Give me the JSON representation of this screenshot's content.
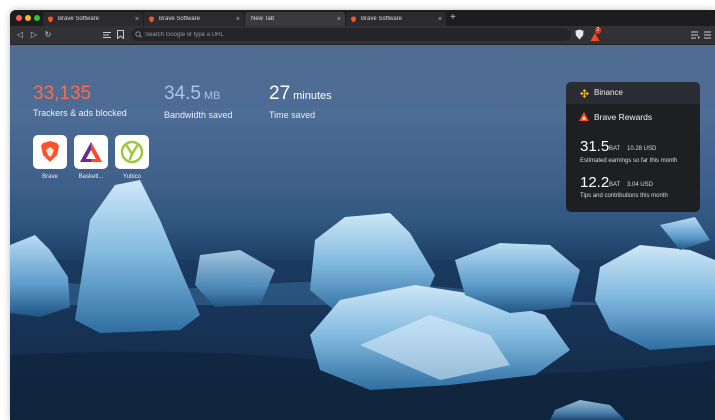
{
  "tabs": [
    {
      "title": "Brave Software",
      "active": false,
      "icon": "brave-lion-icon"
    },
    {
      "title": "Brave Software",
      "active": false,
      "icon": "brave-lion-icon"
    },
    {
      "title": "New Tab",
      "active": true,
      "icon": "none"
    },
    {
      "title": "Brave Software",
      "active": false,
      "icon": "brave-lion-icon"
    }
  ],
  "tab_close": "×",
  "new_tab": "+",
  "toolbar": {
    "back": "◁",
    "forward": "▷",
    "reload": "↻",
    "url_placeholder": "Search Google or type a URL",
    "rewards_badge": "2"
  },
  "stats": {
    "trackers": {
      "value": "33,135",
      "label": "Trackers & ads blocked",
      "color": "#ff6b4a"
    },
    "bandwidth": {
      "value": "34.5",
      "unit": "MB",
      "label": "Bandwidth saved",
      "color": "#a4c6ef"
    },
    "time": {
      "value": "27",
      "unit": "minutes",
      "label": "Time saved",
      "color": "#ffffff"
    }
  },
  "top_sites": [
    {
      "label": "Brave",
      "icon": "brave-lion-icon"
    },
    {
      "label": "Basketl...",
      "icon": "bat-triangle-icon"
    },
    {
      "label": "Yubico",
      "icon": "yubico-icon"
    }
  ],
  "widgets": {
    "binance": {
      "name": "Binance",
      "color": "#f0b90b"
    },
    "rewards": {
      "name": "Brave Rewards",
      "earnings": {
        "value": "31.5",
        "unit": "BAT",
        "usd": "10.28 USD",
        "desc": "Estimated earnings so far this month"
      },
      "tips": {
        "value": "12.2",
        "unit": "BAT",
        "usd": "3.04 USD",
        "desc": "Tips and contributions this month"
      }
    }
  }
}
